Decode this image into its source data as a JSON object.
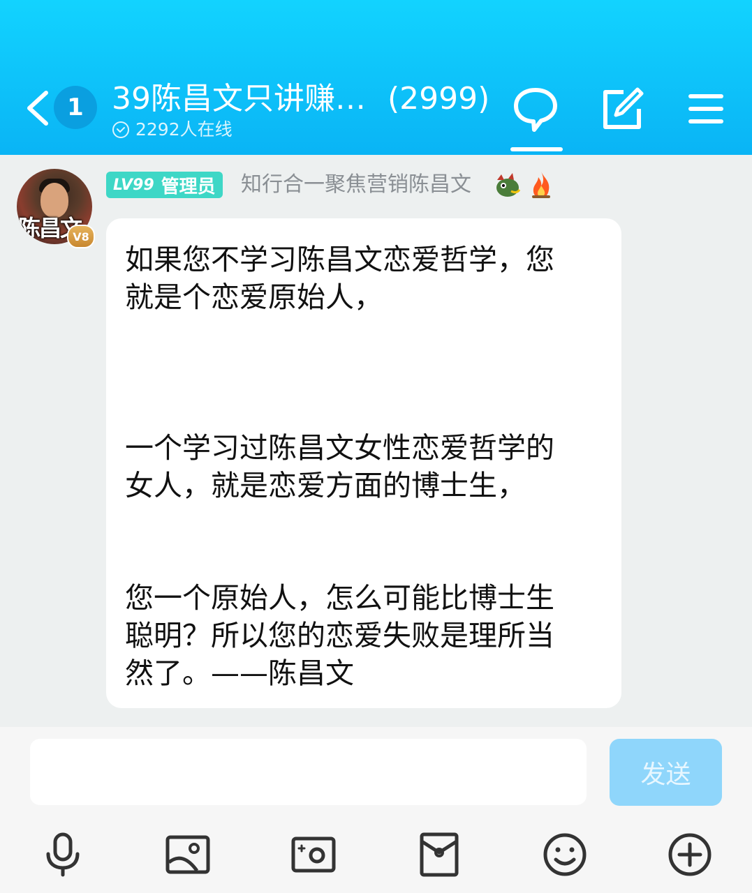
{
  "header": {
    "unread_count": "1",
    "title": "39陈昌文只讲赚…",
    "member_count": "(2999)",
    "online_text": "2292人在线"
  },
  "message": {
    "avatar_text": "陈昌文",
    "vip_label": "V8",
    "level_label": "LV99",
    "role_label": "管理员",
    "sender_name": "知行合一聚焦营销陈昌文",
    "lines": [
      "如果您不学习陈昌文恋爱哲学，您",
      "就是个恋爱原始人，",
      "一个学习过陈昌文女性恋爱哲学的",
      "女人，就是恋爱方面的博士生，",
      "您一个原始人，怎么可能比博士生",
      "聪明？所以您的恋爱失败是理所当",
      "然了。——陈昌文"
    ]
  },
  "composer": {
    "input_value": "",
    "send_label": "发送"
  },
  "colors": {
    "header_top": "#12d3ff",
    "header_bottom": "#0ab4f5",
    "level_tag": "#3ed7c6",
    "send_button": "#8fd6fb"
  },
  "icons": [
    "back-icon",
    "chat-icon",
    "edit-icon",
    "menu-icon",
    "microphone-icon",
    "image-icon",
    "camera-icon",
    "red-packet-icon",
    "emoji-icon",
    "plus-icon"
  ]
}
